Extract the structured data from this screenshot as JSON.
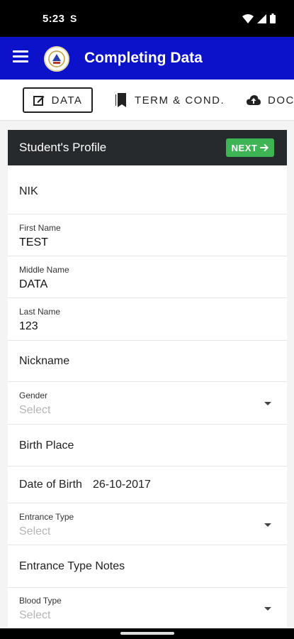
{
  "status_bar": {
    "time": "5:23",
    "notification_glyph": "S"
  },
  "app_bar": {
    "title": "Completing Data"
  },
  "tabs": [
    {
      "label": "DATA",
      "icon": "edit-icon",
      "active": true
    },
    {
      "label": "TERM & COND.",
      "icon": "bookmark-icon",
      "active": false
    },
    {
      "label": "DOCU",
      "icon": "cloud-upload-icon",
      "active": false
    }
  ],
  "panel": {
    "title": "Student's Profile",
    "next_label": "NEXT"
  },
  "fields": {
    "nik": {
      "label": "NIK"
    },
    "first_name": {
      "label": "First Name",
      "value": "TEST"
    },
    "middle_name": {
      "label": "Middle Name",
      "value": "DATA"
    },
    "last_name": {
      "label": "Last Name",
      "value": "123"
    },
    "nickname": {
      "label": "Nickname"
    },
    "gender": {
      "label": "Gender",
      "placeholder": "Select"
    },
    "birth_place": {
      "label": "Birth Place"
    },
    "date_of_birth": {
      "label": "Date of Birth",
      "value": "26-10-2017"
    },
    "entrance_type": {
      "label": "Entrance Type",
      "placeholder": "Select"
    },
    "entrance_type_notes": {
      "label": "Entrance Type Notes"
    },
    "blood_type": {
      "label": "Blood Type",
      "placeholder": "Select"
    }
  },
  "colors": {
    "app_bar": "#0b12c9",
    "panel_header": "#272a2c",
    "next_button": "#3fb455"
  }
}
